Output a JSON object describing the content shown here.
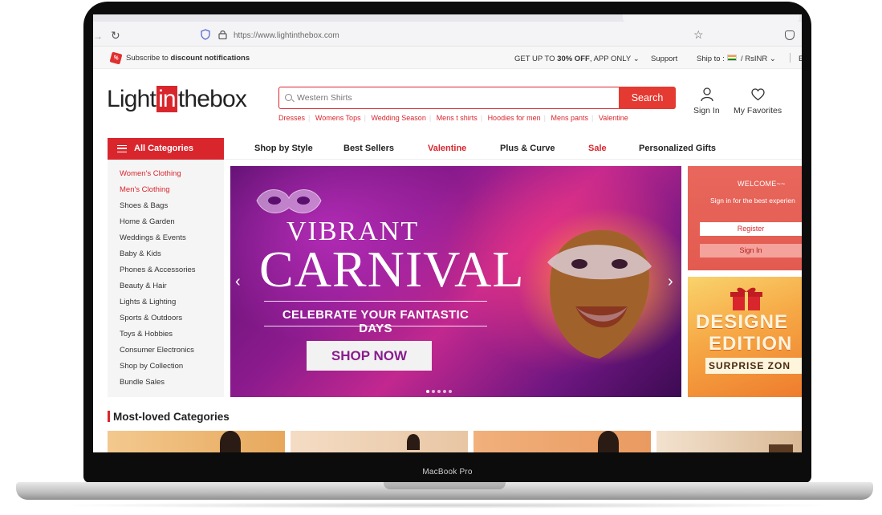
{
  "device": {
    "model_label": "MacBook Pro"
  },
  "browser": {
    "url": "https://www.lightinthebox.com"
  },
  "notice": {
    "subscribe_prefix": "Subscribe to ",
    "subscribe_bold": "discount notifications",
    "promo_prefix": "GET UP TO ",
    "promo_bold": "30% OFF",
    "promo_suffix": ", APP ONLY",
    "support": "Support",
    "ship_to": "Ship to :",
    "currency": "/ RsINR",
    "edge": "E"
  },
  "header": {
    "logo_light": "Light",
    "logo_in": "in",
    "logo_box": "thebox",
    "search_placeholder": "Western Shirts",
    "search_button": "Search",
    "hotwords": [
      "Dresses",
      "Womens Tops",
      "Wedding Season",
      "Mens t shirts",
      "Hoodies for men",
      "Mens pants",
      "Valentine"
    ],
    "sign_in": "Sign In",
    "favorites": "My Favorites"
  },
  "nav": {
    "all_categories": "All Categories",
    "items": [
      "Shop by Style",
      "Best Sellers",
      "Valentine",
      "Plus & Curve",
      "Sale",
      "Personalized Gifts"
    ]
  },
  "sidebar": {
    "items": [
      "Women's Clothing",
      "Men's Clothing",
      "Shoes & Bags",
      "Home & Garden",
      "Weddings & Events",
      "Baby & Kids",
      "Phones & Accessories",
      "Beauty & Hair",
      "Lights & Lighting",
      "Sports & Outdoors",
      "Toys & Hobbies",
      "Consumer Electronics",
      "Shop by Collection",
      "Bundle Sales"
    ]
  },
  "banner": {
    "line1": "VIBRANT",
    "line2": "CARNIVAL",
    "tagline": "CELEBRATE YOUR FANTASTIC DAYS",
    "cta": "SHOP NOW"
  },
  "welcome": {
    "title": "WELCOME~~",
    "subtitle": "Sign in for the best experien",
    "register": "Register",
    "sign_in": "Sign In"
  },
  "promo": {
    "line1": "DESIGNE",
    "line2": "EDITION",
    "line3": "SURPRISE ZON"
  },
  "most_loved": {
    "title": "Most-loved Categories"
  },
  "colors": {
    "brand_red": "#d9262d",
    "welcome_panel": "#e35b50",
    "banner_purple": "#8c1b8e"
  }
}
